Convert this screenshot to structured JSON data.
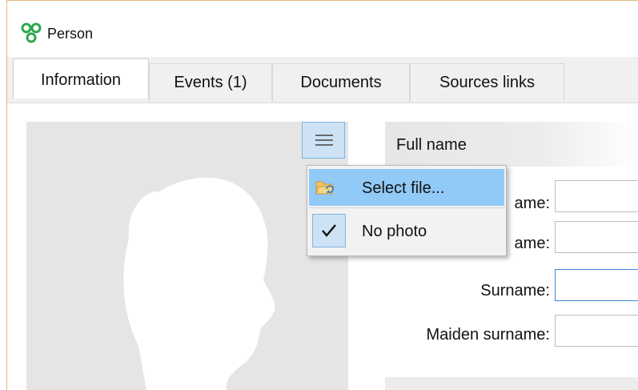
{
  "window": {
    "title": "Person",
    "icon": "app-logo-icon"
  },
  "tabs": [
    {
      "label": "Information",
      "active": true
    },
    {
      "label": "Events (1)",
      "active": false
    },
    {
      "label": "Documents",
      "active": false
    },
    {
      "label": "Sources links",
      "active": false
    }
  ],
  "photo": {
    "placeholder_icon": "female-silhouette-icon",
    "menu_icon": "hamburger-menu-icon"
  },
  "photo_menu": {
    "items": [
      {
        "label": "Select file...",
        "icon": "folder-open-icon",
        "highlighted": true
      },
      {
        "label": "No photo",
        "icon": "checkmark-icon",
        "checked": true
      }
    ]
  },
  "section": {
    "title": "Full name"
  },
  "form": {
    "fields": [
      {
        "label": "ame:",
        "value": ""
      },
      {
        "label": "ame:",
        "value": ""
      },
      {
        "label": "Surname:",
        "value": "",
        "focused": true
      },
      {
        "label": "Maiden surname:",
        "value": ""
      }
    ]
  },
  "colors": {
    "accent_highlight": "#91c9f7",
    "focus_border": "#3c8be0",
    "button_pressed": "#cde3f5",
    "logo_green": "#2fa84f"
  }
}
